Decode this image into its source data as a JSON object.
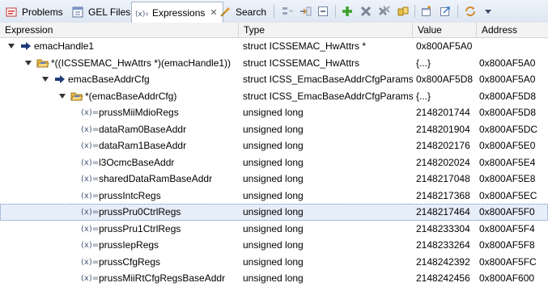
{
  "tabs": [
    {
      "label": "Problems",
      "icon": "problems-icon"
    },
    {
      "label": "GEL Files",
      "icon": "gel-files-icon"
    },
    {
      "label": "Expressions",
      "icon": "expressions-icon",
      "active": true
    },
    {
      "label": "Search",
      "icon": "search-icon"
    }
  ],
  "close_glyph": "✕",
  "toolbar": [
    "show-type-names-icon",
    "collapse-all-icon",
    "collapse-icon",
    "add-expression-icon",
    "remove-expression-icon",
    "remove-all-icon",
    "refresh-icon",
    "new-window-icon",
    "export-icon",
    "sync-icon",
    "view-menu-icon"
  ],
  "columns": {
    "expression": "Expression",
    "type": "Type",
    "value": "Value",
    "address": "Address"
  },
  "rows": [
    {
      "level": 0,
      "kind": "pointer",
      "expanded": true,
      "expr": "emacHandle1",
      "type": "struct ICSSEMAC_HwAttrs *",
      "value": "0x800AF5A0",
      "address": ""
    },
    {
      "level": 1,
      "kind": "struct",
      "expanded": true,
      "expr": "*((ICSSEMAC_HwAttrs *)(emacHandle1))",
      "type": "struct ICSSEMAC_HwAttrs",
      "value": "{...}",
      "address": "0x800AF5A0"
    },
    {
      "level": 2,
      "kind": "pointer",
      "expanded": true,
      "expr": "emacBaseAddrCfg",
      "type": "struct ICSS_EmacBaseAddrCfgParams *",
      "value": "0x800AF5D8",
      "address": "0x800AF5A0"
    },
    {
      "level": 3,
      "kind": "struct",
      "expanded": true,
      "expr": "*(emacBaseAddrCfg)",
      "type": "struct ICSS_EmacBaseAddrCfgParams",
      "value": "{...}",
      "address": "0x800AF5D8"
    },
    {
      "level": 4,
      "kind": "var",
      "expr": "prussMiiMdioRegs",
      "type": "unsigned long",
      "value": "2148201744",
      "address": "0x800AF5D8"
    },
    {
      "level": 4,
      "kind": "var",
      "expr": "dataRam0BaseAddr",
      "type": "unsigned long",
      "value": "2148201904",
      "address": "0x800AF5DC"
    },
    {
      "level": 4,
      "kind": "var",
      "expr": "dataRam1BaseAddr",
      "type": "unsigned long",
      "value": "2148202176",
      "address": "0x800AF5E0"
    },
    {
      "level": 4,
      "kind": "var",
      "expr": "l3OcmcBaseAddr",
      "type": "unsigned long",
      "value": "2148202024",
      "address": "0x800AF5E4"
    },
    {
      "level": 4,
      "kind": "var",
      "expr": "sharedDataRamBaseAddr",
      "type": "unsigned long",
      "value": "2148217048",
      "address": "0x800AF5E8"
    },
    {
      "level": 4,
      "kind": "var",
      "expr": "prussIntcRegs",
      "type": "unsigned long",
      "value": "2148217368",
      "address": "0x800AF5EC"
    },
    {
      "level": 4,
      "kind": "var",
      "selected": true,
      "expr": "prussPru0CtrlRegs",
      "type": "unsigned long",
      "value": "2148217464",
      "address": "0x800AF5F0"
    },
    {
      "level": 4,
      "kind": "var",
      "expr": "prussPru1CtrlRegs",
      "type": "unsigned long",
      "value": "2148233304",
      "address": "0x800AF5F4"
    },
    {
      "level": 4,
      "kind": "var",
      "expr": "prussIepRegs",
      "type": "unsigned long",
      "value": "2148233264",
      "address": "0x800AF5F8"
    },
    {
      "level": 4,
      "kind": "var",
      "expr": "prussCfgRegs",
      "type": "unsigned long",
      "value": "2148242392",
      "address": "0x800AF5FC"
    },
    {
      "level": 4,
      "kind": "var",
      "expr": "prussMiiRtCfgRegsBaseAddr",
      "type": "unsigned long",
      "value": "2148242456",
      "address": "0x800AF600"
    }
  ],
  "var_glyph": "(x)=",
  "colors": {
    "selected_row": "#e6eef9",
    "header_bg": "#f3f3f3",
    "tab_bg": "#dde6f2"
  }
}
